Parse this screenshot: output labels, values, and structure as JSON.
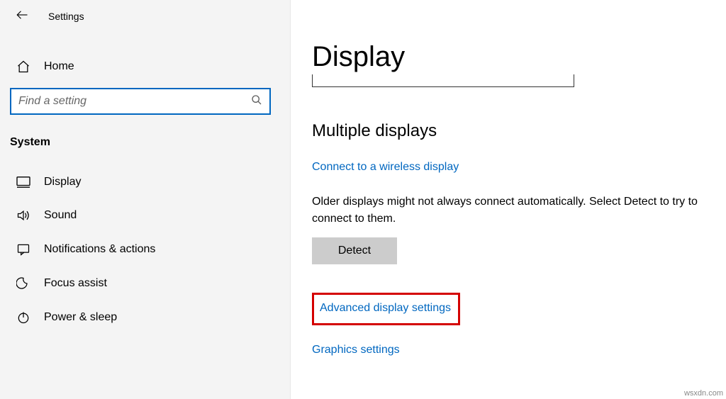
{
  "header": {
    "title": "Settings"
  },
  "home": {
    "label": "Home"
  },
  "search": {
    "placeholder": "Find a setting"
  },
  "category": {
    "title": "System"
  },
  "nav": {
    "items": [
      {
        "label": "Display",
        "icon": "display"
      },
      {
        "label": "Sound",
        "icon": "sound"
      },
      {
        "label": "Notifications & actions",
        "icon": "notifications"
      },
      {
        "label": "Focus assist",
        "icon": "focus"
      },
      {
        "label": "Power & sleep",
        "icon": "power"
      }
    ]
  },
  "main": {
    "page_title": "Display",
    "section_title": "Multiple displays",
    "wireless_link": "Connect to a wireless display",
    "older_text": "Older displays might not always connect automatically. Select Detect to try to connect to them.",
    "detect_button": "Detect",
    "advanced_link": "Advanced display settings",
    "graphics_link": "Graphics settings"
  },
  "watermark": "wsxdn.com"
}
